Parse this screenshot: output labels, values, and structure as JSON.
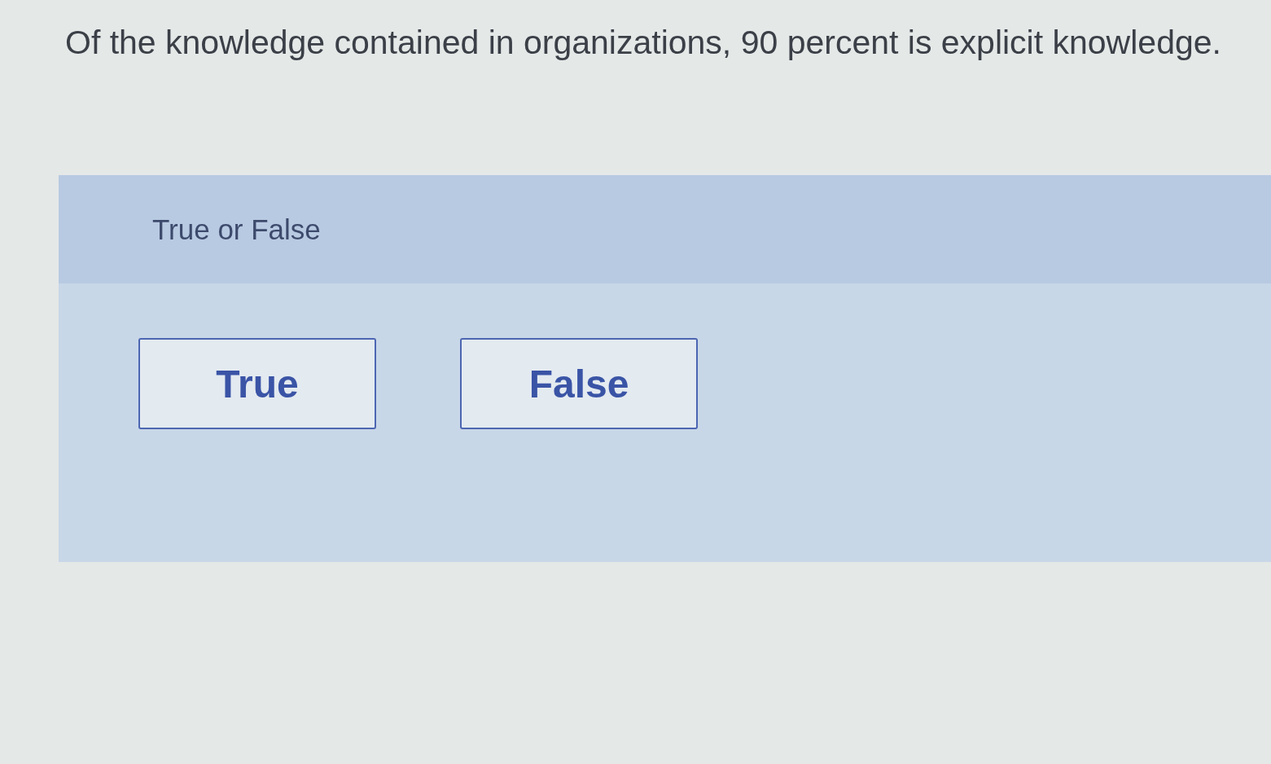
{
  "question": {
    "text": "Of the knowledge contained in organizations, 90 percent is explicit knowledge."
  },
  "answer_panel": {
    "prompt": "True or False",
    "options": [
      {
        "label": "True",
        "selected": false
      },
      {
        "label": "False",
        "selected": false
      }
    ]
  }
}
